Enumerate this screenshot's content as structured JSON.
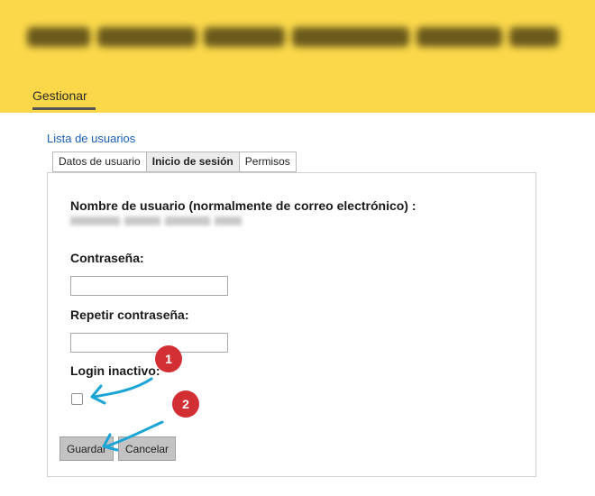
{
  "header": {
    "site_title_blurred": "developer_platform.example",
    "nav_tab": "Gestionar"
  },
  "back_link": "Lista de usuarios",
  "tabs": [
    {
      "label": "Datos de usuario",
      "active": false
    },
    {
      "label": "Inicio de sesión",
      "active": true
    },
    {
      "label": "Permisos",
      "active": false
    }
  ],
  "form": {
    "username_label": "Nombre de usuario (normalmente de correo electrónico) :",
    "password_label": "Contraseña:",
    "password_value": "",
    "repeat_password_label": "Repetir contraseña:",
    "repeat_password_value": "",
    "login_inactive_label": "Login inactivo:",
    "login_inactive_checked": false
  },
  "buttons": {
    "save": "Guardar",
    "cancel": "Cancelar"
  },
  "annotations": {
    "badge_1": "1",
    "badge_2": "2",
    "color": "#d22f35",
    "arrow_color": "#1ba5d6"
  },
  "colors": {
    "header_bg": "#fad84a",
    "link": "#1a5fb4"
  }
}
